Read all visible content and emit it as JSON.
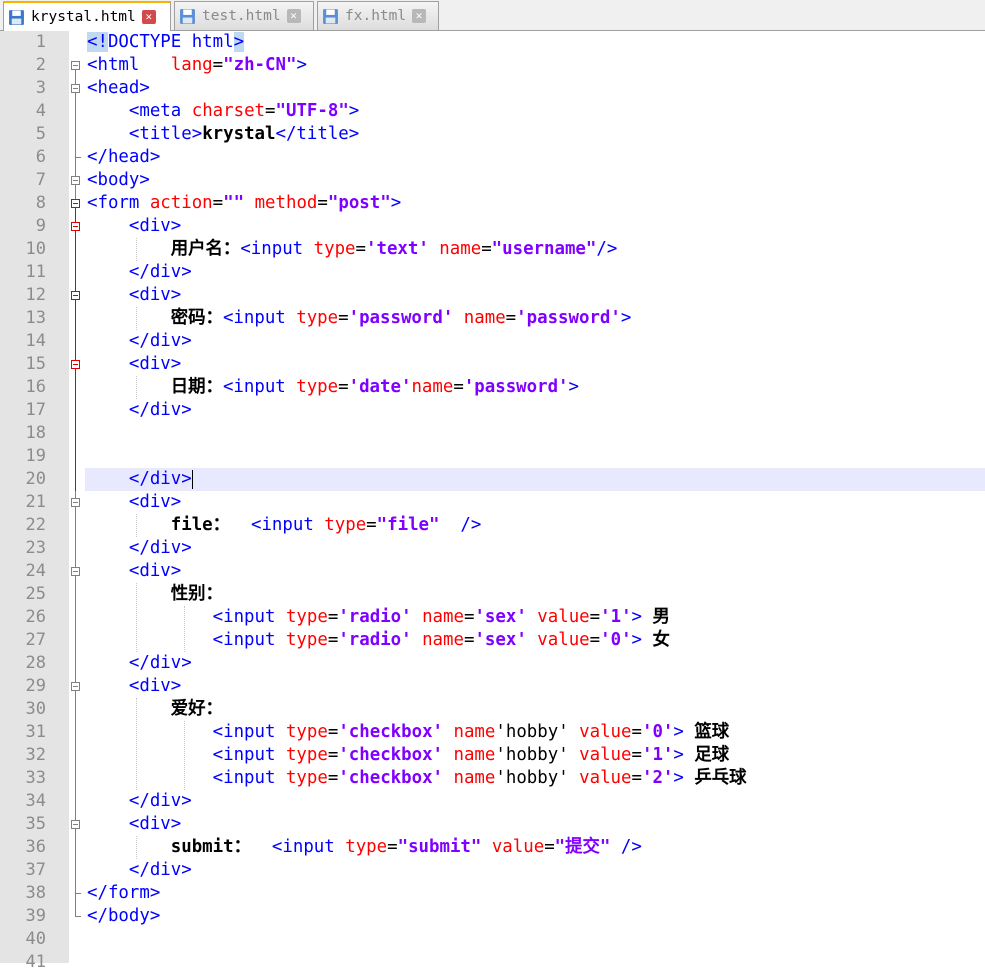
{
  "tabs": [
    {
      "label": "krystal.html",
      "active": true
    },
    {
      "label": "test.html",
      "active": false
    },
    {
      "label": "fx.html",
      "active": false
    }
  ],
  "line_numbers": [
    "1",
    "2",
    "3",
    "4",
    "5",
    "6",
    "7",
    "8",
    "9",
    "10",
    "11",
    "12",
    "13",
    "14",
    "15",
    "16",
    "17",
    "18",
    "19",
    "20",
    "21",
    "22",
    "23",
    "24",
    "25",
    "26",
    "27",
    "28",
    "29",
    "30",
    "31",
    "32",
    "33",
    "34",
    "35",
    "36",
    "37",
    "38",
    "39",
    "40",
    "41"
  ],
  "current_line": 20,
  "colors": {
    "tag": "#0000ff",
    "attribute": "#ff0000",
    "string": "#8000ff",
    "text": "#000000",
    "fold_active": "#e00000",
    "current_line_bg": "#e8e8ff"
  },
  "code_lines": [
    [
      [
        "doc",
        "<!"
      ],
      [
        "tg",
        "DOCTYPE html"
      ],
      [
        "doc",
        ">"
      ]
    ],
    [
      [
        "tg",
        "<html   "
      ],
      [
        "at",
        "lang"
      ],
      [
        "eq",
        "="
      ],
      [
        "sv",
        "\"zh-CN\""
      ],
      [
        "tg",
        ">"
      ]
    ],
    [
      [
        "tg",
        "<head>"
      ]
    ],
    [
      [
        "tx",
        "    "
      ],
      [
        "tg",
        "<meta "
      ],
      [
        "at",
        "charset"
      ],
      [
        "eq",
        "="
      ],
      [
        "sv",
        "\"UTF-8\""
      ],
      [
        "tg",
        ">"
      ]
    ],
    [
      [
        "tx",
        "    "
      ],
      [
        "tg",
        "<title>"
      ],
      [
        "tx",
        "krystal"
      ],
      [
        "tg",
        "</title>"
      ]
    ],
    [
      [
        "tg",
        "</head>"
      ]
    ],
    [
      [
        "tg",
        "<body>"
      ]
    ],
    [
      [
        "tg",
        "<form "
      ],
      [
        "at",
        "action"
      ],
      [
        "eq",
        "="
      ],
      [
        "sv",
        "\"\" "
      ],
      [
        "at",
        "method"
      ],
      [
        "eq",
        "="
      ],
      [
        "sv",
        "\"post\""
      ],
      [
        "tg",
        ">"
      ]
    ],
    [
      [
        "tx",
        "    "
      ],
      [
        "tg",
        "<div>"
      ]
    ],
    [
      [
        "tx",
        "        用户名："
      ],
      [
        "tg",
        "<input "
      ],
      [
        "at",
        "type"
      ],
      [
        "eq",
        "="
      ],
      [
        "sv",
        "'text' "
      ],
      [
        "at",
        "name"
      ],
      [
        "eq",
        "="
      ],
      [
        "sv",
        "\"username\""
      ],
      [
        "tg",
        "/>"
      ]
    ],
    [
      [
        "tx",
        "    "
      ],
      [
        "tg",
        "</div>"
      ]
    ],
    [
      [
        "tx",
        "    "
      ],
      [
        "tg",
        "<div>"
      ]
    ],
    [
      [
        "tx",
        "        密码："
      ],
      [
        "tg",
        "<input "
      ],
      [
        "at",
        "type"
      ],
      [
        "eq",
        "="
      ],
      [
        "sv",
        "'password' "
      ],
      [
        "at",
        "name"
      ],
      [
        "eq",
        "="
      ],
      [
        "sv",
        "'password'"
      ],
      [
        "tg",
        ">"
      ]
    ],
    [
      [
        "tx",
        "    "
      ],
      [
        "tg",
        "</div>"
      ]
    ],
    [
      [
        "tx",
        "    "
      ],
      [
        "tg",
        "<div>"
      ]
    ],
    [
      [
        "tx",
        "        日期："
      ],
      [
        "tg",
        "<input "
      ],
      [
        "at",
        "type"
      ],
      [
        "eq",
        "="
      ],
      [
        "sv",
        "'date'"
      ],
      [
        "at",
        "name"
      ],
      [
        "eq",
        "="
      ],
      [
        "sv",
        "'password'"
      ],
      [
        "tg",
        ">"
      ]
    ],
    [
      [
        "tx",
        "    "
      ],
      [
        "tg",
        "</div>"
      ]
    ],
    [],
    [],
    [
      [
        "tx",
        "    "
      ],
      [
        "tg",
        "</div>"
      ],
      [
        "cursor",
        ""
      ]
    ],
    [
      [
        "tx",
        "    "
      ],
      [
        "tg",
        "<div>"
      ]
    ],
    [
      [
        "tx",
        "        file：  "
      ],
      [
        "tg",
        "<input "
      ],
      [
        "at",
        "type"
      ],
      [
        "eq",
        "="
      ],
      [
        "sv",
        "\"file\"  "
      ],
      [
        "tg",
        "/>"
      ]
    ],
    [
      [
        "tx",
        "    "
      ],
      [
        "tg",
        "</div>"
      ]
    ],
    [
      [
        "tx",
        "    "
      ],
      [
        "tg",
        "<div>"
      ]
    ],
    [
      [
        "tx",
        "        性别："
      ]
    ],
    [
      [
        "tx",
        "            "
      ],
      [
        "tg",
        "<input "
      ],
      [
        "at",
        "type"
      ],
      [
        "eq",
        "="
      ],
      [
        "sv",
        "'radio' "
      ],
      [
        "at",
        "name"
      ],
      [
        "eq",
        "="
      ],
      [
        "sv",
        "'sex' "
      ],
      [
        "at",
        "value"
      ],
      [
        "eq",
        "="
      ],
      [
        "sv",
        "'1'"
      ],
      [
        "tg",
        "> "
      ],
      [
        "tx",
        "男"
      ]
    ],
    [
      [
        "tx",
        "            "
      ],
      [
        "tg",
        "<input "
      ],
      [
        "at",
        "type"
      ],
      [
        "eq",
        "="
      ],
      [
        "sv",
        "'radio' "
      ],
      [
        "at",
        "name"
      ],
      [
        "eq",
        "="
      ],
      [
        "sv",
        "'sex' "
      ],
      [
        "at",
        "value"
      ],
      [
        "eq",
        "="
      ],
      [
        "sv",
        "'0'"
      ],
      [
        "tg",
        "> "
      ],
      [
        "tx",
        "女"
      ]
    ],
    [
      [
        "tx",
        "    "
      ],
      [
        "tg",
        "</div>"
      ]
    ],
    [
      [
        "tx",
        "    "
      ],
      [
        "tg",
        "<div>"
      ]
    ],
    [
      [
        "tx",
        "        爱好："
      ]
    ],
    [
      [
        "tx",
        "            "
      ],
      [
        "tg",
        "<input "
      ],
      [
        "at",
        "type"
      ],
      [
        "eq",
        "="
      ],
      [
        "sv",
        "'checkbox' "
      ],
      [
        "at",
        "name"
      ],
      [
        "eq",
        "'hobby' "
      ],
      [
        "at",
        "value"
      ],
      [
        "eq",
        "="
      ],
      [
        "sv",
        "'0'"
      ],
      [
        "tg",
        "> "
      ],
      [
        "tx",
        "篮球"
      ]
    ],
    [
      [
        "tx",
        "            "
      ],
      [
        "tg",
        "<input "
      ],
      [
        "at",
        "type"
      ],
      [
        "eq",
        "="
      ],
      [
        "sv",
        "'checkbox' "
      ],
      [
        "at",
        "name"
      ],
      [
        "eq",
        "'hobby' "
      ],
      [
        "at",
        "value"
      ],
      [
        "eq",
        "="
      ],
      [
        "sv",
        "'1'"
      ],
      [
        "tg",
        "> "
      ],
      [
        "tx",
        "足球"
      ]
    ],
    [
      [
        "tx",
        "            "
      ],
      [
        "tg",
        "<input "
      ],
      [
        "at",
        "type"
      ],
      [
        "eq",
        "="
      ],
      [
        "sv",
        "'checkbox' "
      ],
      [
        "at",
        "name"
      ],
      [
        "eq",
        "'hobby' "
      ],
      [
        "at",
        "value"
      ],
      [
        "eq",
        "="
      ],
      [
        "sv",
        "'2'"
      ],
      [
        "tg",
        "> "
      ],
      [
        "tx",
        "乒乓球"
      ]
    ],
    [
      [
        "tx",
        "    "
      ],
      [
        "tg",
        "</div>"
      ]
    ],
    [
      [
        "tx",
        "    "
      ],
      [
        "tg",
        "<div>"
      ]
    ],
    [
      [
        "tx",
        "        submit：  "
      ],
      [
        "tg",
        "<input "
      ],
      [
        "at",
        "type"
      ],
      [
        "eq",
        "="
      ],
      [
        "sv",
        "\"submit\" "
      ],
      [
        "at",
        "value"
      ],
      [
        "eq",
        "="
      ],
      [
        "sv",
        "\"提交\" "
      ],
      [
        "tg",
        "/>"
      ]
    ],
    [
      [
        "tx",
        "    "
      ],
      [
        "tg",
        "</div>"
      ]
    ],
    [
      [
        "tg",
        "</form>"
      ]
    ],
    [
      [
        "tg",
        "</body>"
      ]
    ],
    [],
    []
  ]
}
